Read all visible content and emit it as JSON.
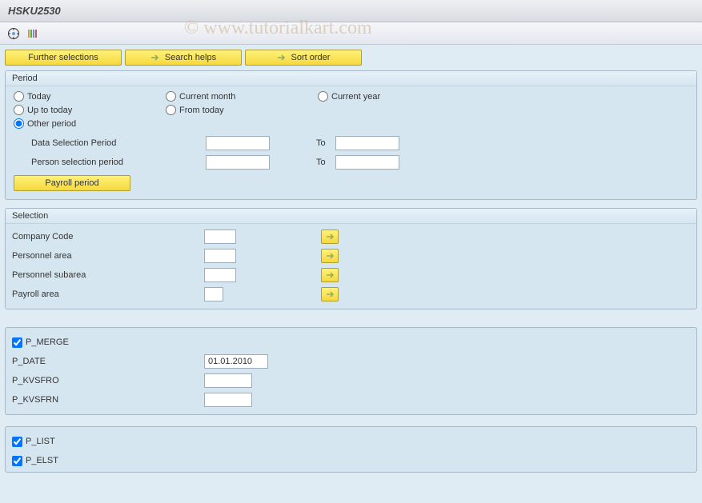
{
  "title": "HSKU2530",
  "watermark": "© www.tutorialkart.com",
  "buttons": {
    "further_selections": "Further selections",
    "search_helps": "Search helps",
    "sort_order": "Sort order",
    "payroll_period": "Payroll period"
  },
  "period": {
    "title": "Period",
    "today": "Today",
    "current_month": "Current month",
    "current_year": "Current year",
    "up_to_today": "Up to today",
    "from_today": "From today",
    "other_period": "Other period",
    "data_selection": "Data Selection Period",
    "person_selection": "Person selection period",
    "to": "To",
    "data_from": "",
    "data_to": "",
    "person_from": "",
    "person_to": ""
  },
  "selection": {
    "title": "Selection",
    "company_code_label": "Company Code",
    "company_code": "",
    "personnel_area_label": "Personnel area",
    "personnel_area": "",
    "personnel_subarea_label": "Personnel subarea",
    "personnel_subarea": "",
    "payroll_area_label": "Payroll area",
    "payroll_area": ""
  },
  "params1": {
    "p_merge_label": "P_MERGE",
    "p_date_label": "P_DATE",
    "p_date_value": "01.01.2010",
    "p_kvsfro_label": "P_KVSFRO",
    "p_kvsfro_value": "",
    "p_kvsfrn_label": "P_KVSFRN",
    "p_kvsfrn_value": ""
  },
  "params2": {
    "p_list_label": "P_LIST",
    "p_elst_label": "P_ELST"
  }
}
